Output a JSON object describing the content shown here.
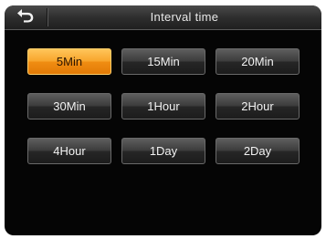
{
  "header": {
    "title": "Interval time",
    "back_icon": "return-arrow-icon"
  },
  "options": [
    {
      "label": "5Min",
      "selected": true
    },
    {
      "label": "15Min",
      "selected": false
    },
    {
      "label": "20Min",
      "selected": false
    },
    {
      "label": "30Min",
      "selected": false
    },
    {
      "label": "1Hour",
      "selected": false
    },
    {
      "label": "2Hour",
      "selected": false
    },
    {
      "label": "4Hour",
      "selected": false
    },
    {
      "label": "1Day",
      "selected": false
    },
    {
      "label": "2Day",
      "selected": false
    }
  ],
  "colors": {
    "selected": "#F39A1E",
    "button": "#3A3A3A",
    "background": "#050505"
  }
}
